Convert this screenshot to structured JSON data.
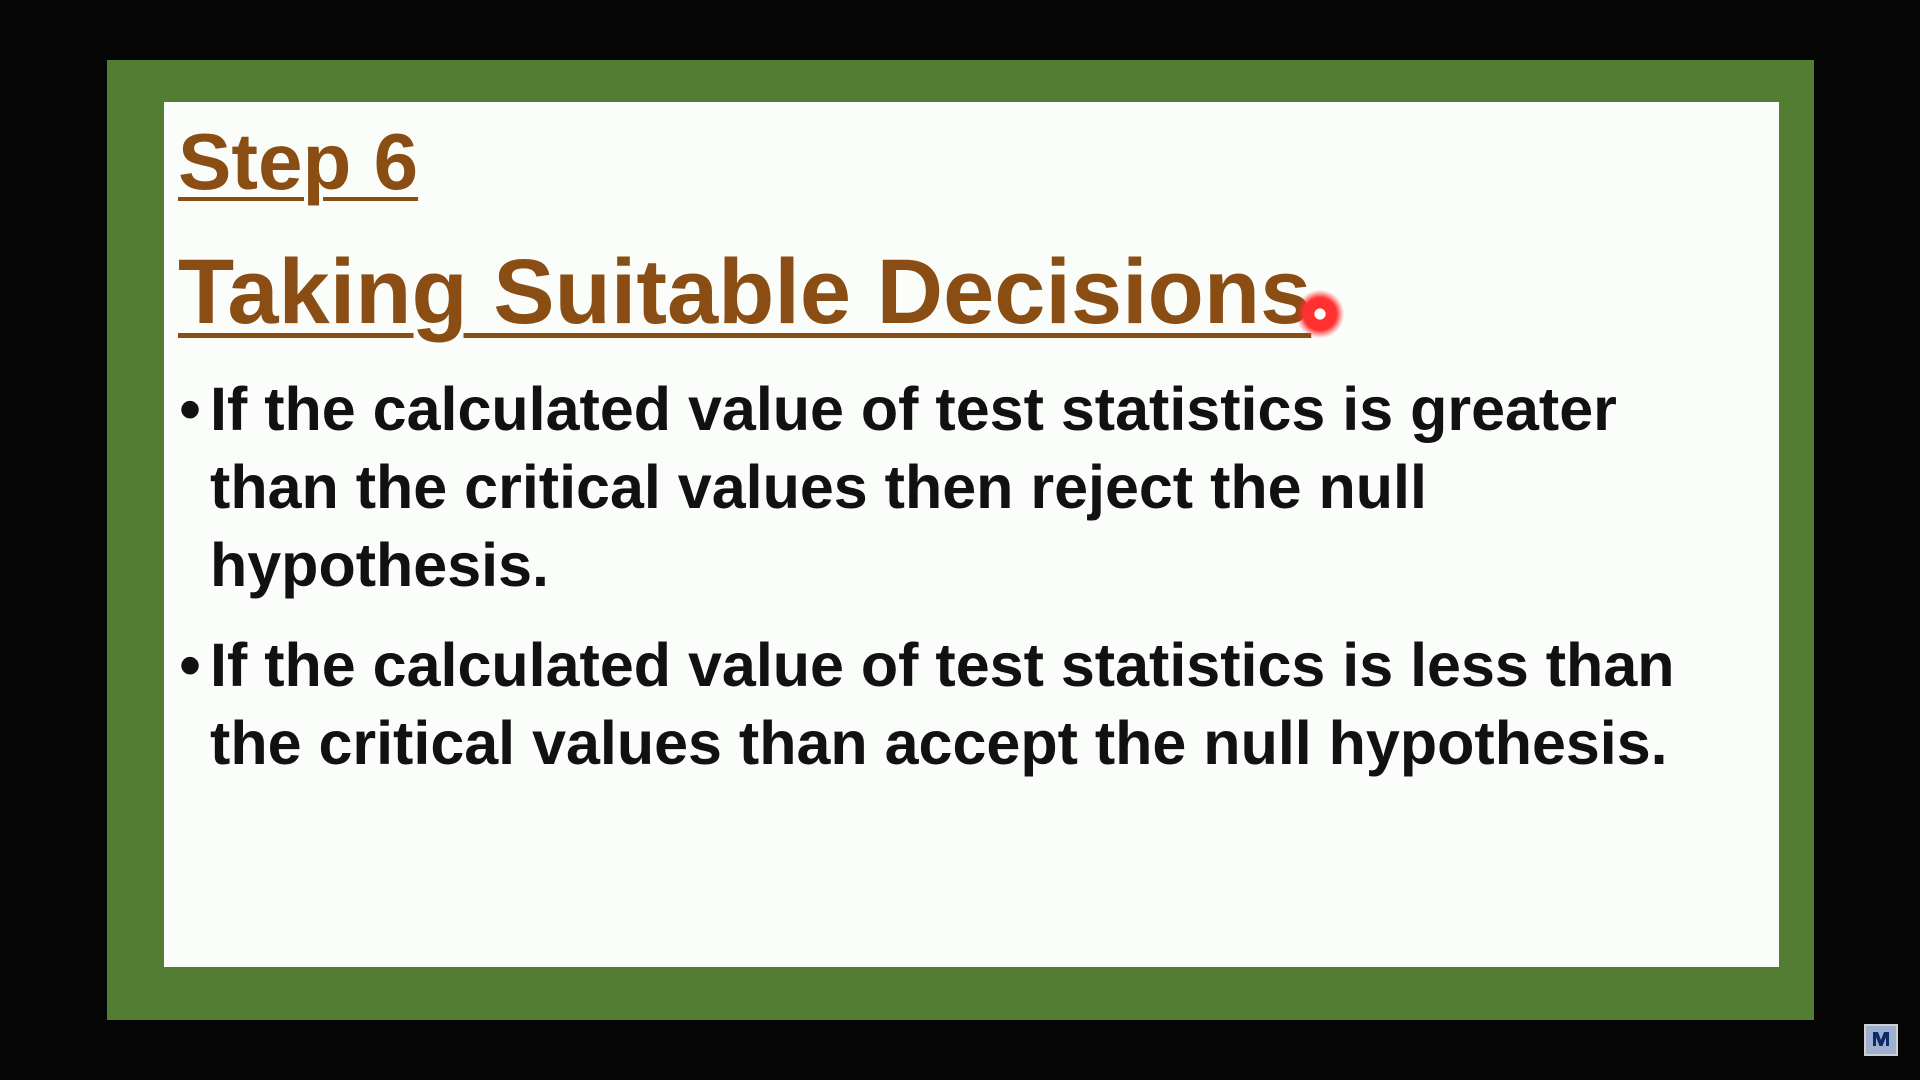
{
  "slide": {
    "step_title": "Step 6",
    "main_title": "Taking Suitable Decisions",
    "bullets": [
      "If the calculated value of test statistics is greater than the critical values then reject the null hypothesis.",
      "If the calculated value of test statistics is less than the critical values than accept the null hypothesis."
    ],
    "bullet_symbol": "•"
  },
  "colors": {
    "frame_green": "#547d34",
    "title_brown": "#8a4e14",
    "slide_background": "#fbfdfb",
    "pointer_red": "#ff3030"
  },
  "icons": {
    "pointer": "laser-pointer-dot-icon",
    "corner": "channel-logo-icon"
  }
}
